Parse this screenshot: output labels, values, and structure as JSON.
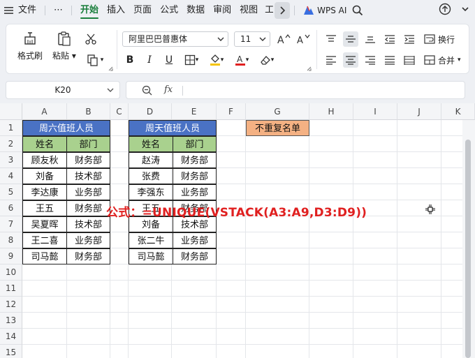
{
  "menu": {
    "file": "文件",
    "more": "⋯",
    "tabs": [
      "开始",
      "插入",
      "页面",
      "公式",
      "数据",
      "审阅",
      "视图",
      "工"
    ],
    "active_tab": "开始",
    "wps_ai": "WPS AI"
  },
  "ribbon": {
    "format_painter": "格式刷",
    "paste": "粘贴",
    "font_name": "阿里巴巴普惠体",
    "font_size": "11",
    "wrap": "换行",
    "merge": "合并",
    "bold": "B",
    "italic": "I",
    "underline": "U"
  },
  "formula_bar": {
    "cell_ref": "K20",
    "fx_label": "fx",
    "formula": ""
  },
  "columns": [
    "A",
    "B",
    "C",
    "D",
    "E",
    "F",
    "G",
    "H",
    "I",
    "J",
    "K"
  ],
  "rows": [
    "1",
    "2",
    "3",
    "4",
    "5",
    "6",
    "7",
    "8",
    "9",
    "10",
    "11",
    "12",
    "13",
    "14",
    "15"
  ],
  "saturday_table": {
    "title": "周六值班人员",
    "headers": [
      "姓名",
      "部门"
    ],
    "rows": [
      [
        "顾友秋",
        "财务部"
      ],
      [
        "刘备",
        "技术部"
      ],
      [
        "李达康",
        "业务部"
      ],
      [
        "王五",
        "财务部"
      ],
      [
        "吴夏晖",
        "技术部"
      ],
      [
        "王二喜",
        "业务部"
      ],
      [
        "司马懿",
        "财务部"
      ]
    ]
  },
  "sunday_table": {
    "title": "周天值班人员",
    "headers": [
      "姓名",
      "部门"
    ],
    "rows": [
      [
        "赵涛",
        "财务部"
      ],
      [
        "张费",
        "财务部"
      ],
      [
        "李强东",
        "业务部"
      ],
      [
        "王五",
        "财务部"
      ],
      [
        "刘备",
        "技术部"
      ],
      [
        "张二牛",
        "业务部"
      ],
      [
        "司马懿",
        "财务部"
      ]
    ]
  },
  "unique_header": "不重复名单",
  "formula_note": "公式：=UNIQUE(VSTACK(A3:A9,D3:D9))",
  "colors": {
    "blue_header": "#4a72c4",
    "green_header": "#a9d18e",
    "orange_header": "#f4b183",
    "formula_note": "#e02020",
    "active_tab": "#1a7f3c"
  }
}
